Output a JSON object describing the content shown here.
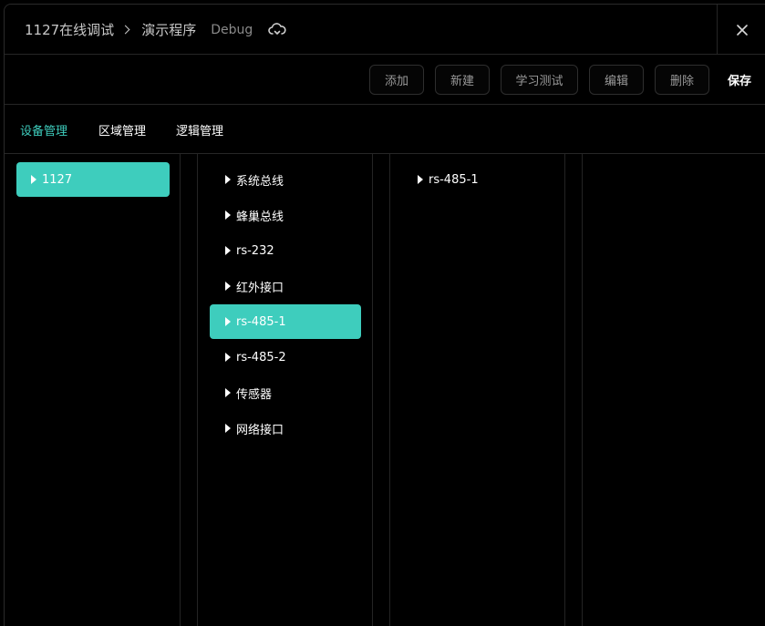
{
  "header": {
    "breadcrumb_root": "1127在线调试",
    "breadcrumb_current": "演示程序",
    "badge": "Debug",
    "cloud_icon": "cloud-sync-icon",
    "close_icon": "close-icon"
  },
  "toolbar": {
    "add_label": "添加",
    "new_label": "新建",
    "learn_test_label": "学习测试",
    "edit_label": "编辑",
    "delete_label": "删除",
    "save_label": "保存"
  },
  "tabs": [
    {
      "label": "设备管理",
      "active": true
    },
    {
      "label": "区域管理",
      "active": false
    },
    {
      "label": "逻辑管理",
      "active": false
    }
  ],
  "columns": {
    "devices": [
      {
        "label": "1127",
        "selected": true
      }
    ],
    "buses": [
      {
        "label": "系统总线",
        "selected": false
      },
      {
        "label": "蜂巢总线",
        "selected": false
      },
      {
        "label": "rs-232",
        "selected": false
      },
      {
        "label": "红外接口",
        "selected": false
      },
      {
        "label": "rs-485-1",
        "selected": true
      },
      {
        "label": "rs-485-2",
        "selected": false
      },
      {
        "label": "传感器",
        "selected": false
      },
      {
        "label": "网络接口",
        "selected": false
      }
    ],
    "children": [
      {
        "label": "rs-485-1",
        "selected": false
      }
    ]
  },
  "colors": {
    "accent": "#3ecdbd",
    "background": "#000000",
    "border": "#262626",
    "button_text": "#9a9a9a"
  }
}
